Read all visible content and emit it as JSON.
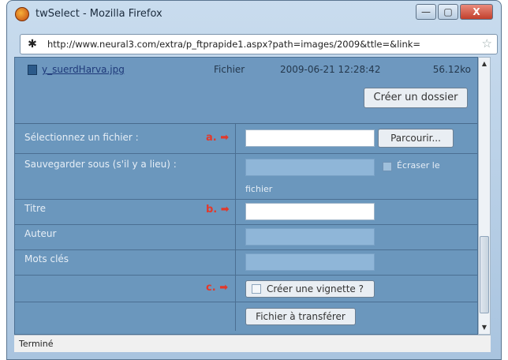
{
  "window": {
    "title": "twSelect - Mozilla Firefox",
    "minimize_label": "—",
    "maximize_label": "▢",
    "close_label": "X"
  },
  "address": {
    "url": "http://www.neural3.com/extra/p_ftprapide1.aspx?path=images/2009&ttle=&link="
  },
  "files": [
    {
      "name": "y_suerdHarva.jpg",
      "type": "Fichier",
      "date": "2009-06-21 12:28:42",
      "size": "56.12ko"
    }
  ],
  "buttons": {
    "create_folder": "Créer un dossier",
    "browse": "Parcourir...",
    "upload": "Fichier à transférer"
  },
  "form": {
    "select_file_label": "Sélectionnez un fichier :",
    "save_as_label": "Sauvegarder sous (s'il y a lieu) :",
    "overwrite_label": "Écraser le",
    "overwrite_label_2": "fichier",
    "title_label": "Titre",
    "author_label": "Auteur",
    "keywords_label": "Mots clés",
    "thumbnail_label": "Créer une vignette ?"
  },
  "markers": {
    "a": "a.",
    "b": "b.",
    "c": "c.",
    "arrow": "➡"
  },
  "status": {
    "text": "Terminé"
  },
  "colors": {
    "content_bg": "#6b97bd",
    "marker": "#e2392b"
  }
}
